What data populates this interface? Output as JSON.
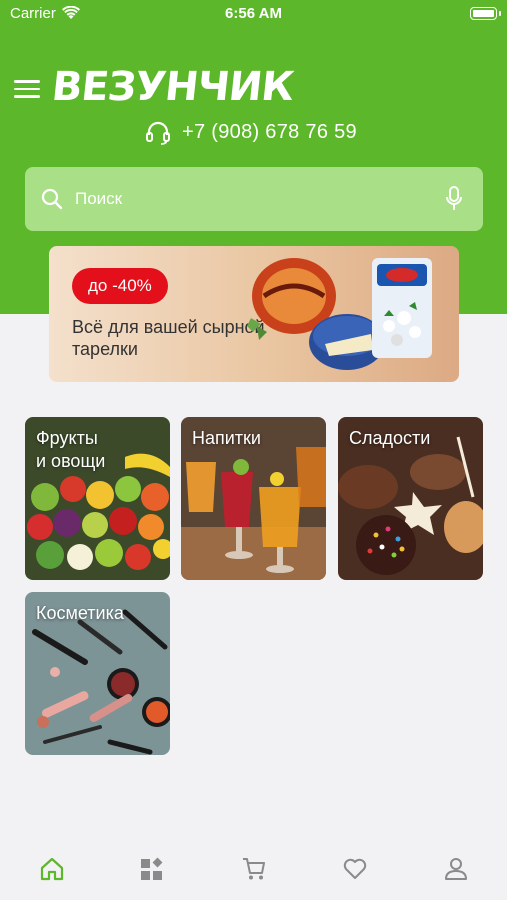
{
  "status_bar": {
    "carrier": "Carrier",
    "time": "6:56 AM"
  },
  "header": {
    "logo": "ВЕЗУНЧИК",
    "phone": "+7 (908) 678 76 59",
    "background_color": "#5cb82a"
  },
  "search": {
    "placeholder": "Поиск"
  },
  "banner": {
    "badge": "до -40%",
    "text": "Всё для вашей сырной тарелки",
    "badge_color": "#e3101b"
  },
  "categories": [
    {
      "label": "Фрукты\nи овощи"
    },
    {
      "label": "Напитки"
    },
    {
      "label": "Сладости"
    },
    {
      "label": "Косметика"
    }
  ],
  "tab_bar": {
    "items": [
      {
        "icon": "home-icon",
        "active": true
      },
      {
        "icon": "catalog-icon",
        "active": false
      },
      {
        "icon": "cart-icon",
        "active": false
      },
      {
        "icon": "heart-icon",
        "active": false
      },
      {
        "icon": "profile-icon",
        "active": false
      }
    ],
    "active_color": "#5cb82a",
    "inactive_color": "#8a8a8a"
  }
}
